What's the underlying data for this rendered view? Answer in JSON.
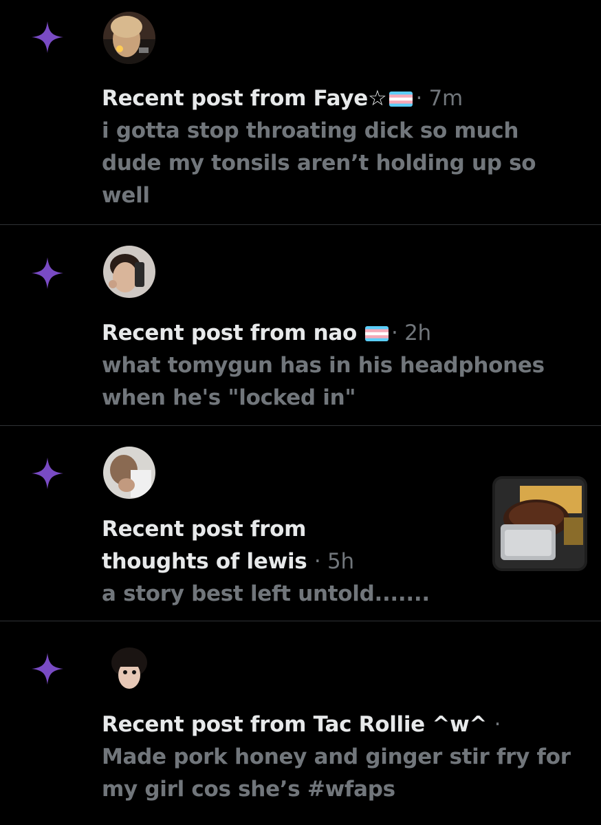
{
  "colors": {
    "background": "#000000",
    "divider": "#2f3336",
    "sparkle": "#794bc4",
    "primary_text": "#e7e9ea",
    "secondary_text": "#71767b"
  },
  "notifications": [
    {
      "icon": "sparkle-icon",
      "heading": "Recent post from Faye☆",
      "flag": "trans-flag-icon",
      "meta": "· 7m",
      "body_lines": [
        "i gotta stop throating dick so much",
        "dude my tonsils aren’t holding up so",
        "well"
      ]
    },
    {
      "icon": "sparkle-icon",
      "heading": "Recent post from nao",
      "flag": "trans-flag-icon",
      "meta": "· 2h",
      "body_lines": [
        "what tomygun has in his headphones",
        "when he's \"locked in\""
      ]
    },
    {
      "icon": "sparkle-icon",
      "heading_lines": [
        "Recent post from",
        "thoughts of lewis"
      ],
      "meta": "· 5h",
      "body_lines": [
        "a story best left untold......."
      ]
    },
    {
      "icon": "sparkle-icon",
      "heading": "Recent post from Tac Rollie ^w^",
      "meta": "·",
      "body_lines": [
        "Made pork honey and ginger stir fry for",
        "my girl cos she’s #wfaps"
      ]
    }
  ]
}
